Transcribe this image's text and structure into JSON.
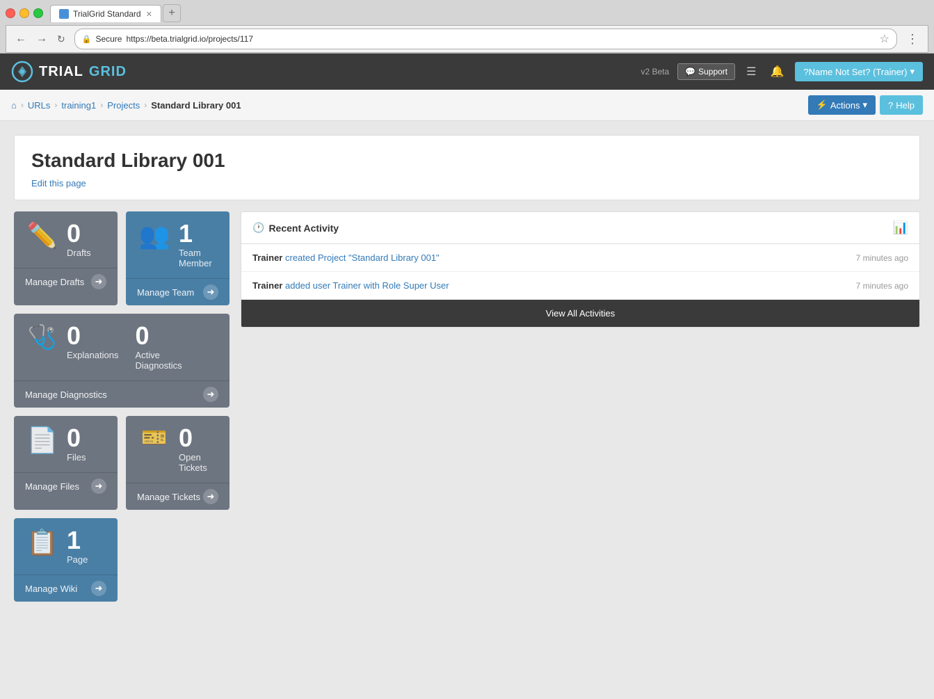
{
  "browser": {
    "tab_label": "TrialGrid Standard",
    "url": "https://beta.trialgrid.io/projects/117",
    "secure_label": "Secure"
  },
  "nav": {
    "logo_trial": "TRIAL",
    "logo_grid": "GRID",
    "beta_label": "v2 Beta",
    "support_label": "Support",
    "user_label": "?Name Not Set? (Trainer)"
  },
  "breadcrumb": {
    "home_icon": "⌂",
    "urls_label": "URLs",
    "training_label": "training1",
    "projects_label": "Projects",
    "current_label": "Standard Library 001",
    "actions_label": "Actions",
    "help_label": "Help"
  },
  "page": {
    "title": "Standard Library 001",
    "edit_link": "Edit this page"
  },
  "cards": {
    "drafts": {
      "count": "0",
      "label": "Drafts",
      "manage_label": "Manage Drafts"
    },
    "team": {
      "count": "1",
      "label": "Team Member",
      "manage_label": "Manage Team"
    },
    "diagnostics": {
      "explanations_count": "0",
      "explanations_label": "Explanations",
      "active_count": "0",
      "active_label": "Active\nDiagnostics",
      "manage_label": "Manage Diagnostics"
    },
    "files": {
      "count": "0",
      "label": "Files",
      "manage_label": "Manage Files"
    },
    "tickets": {
      "count": "0",
      "label": "Open\nTickets",
      "manage_label": "Manage Tickets"
    },
    "wiki": {
      "count": "1",
      "label": "Page",
      "manage_label": "Manage Wiki"
    }
  },
  "activity": {
    "section_title": "Recent Activity",
    "items": [
      {
        "user": "Trainer",
        "action": "created Project \"Standard Library 001\"",
        "time": "7 minutes ago"
      },
      {
        "user": "Trainer",
        "action": "added user Trainer with Role Super User",
        "time": "7 minutes ago"
      }
    ],
    "view_all_label": "View All Activities"
  }
}
